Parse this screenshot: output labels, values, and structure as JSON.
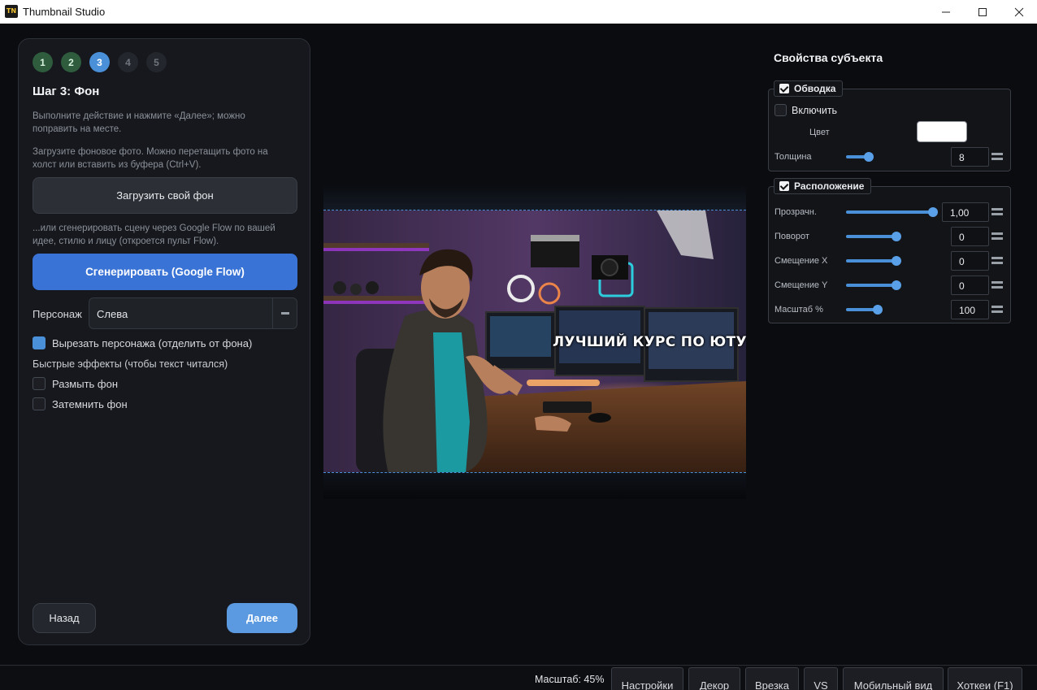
{
  "window": {
    "logo": "TN",
    "title": "Thumbnail Studio"
  },
  "wizard": {
    "steps": [
      {
        "number": "1",
        "state": "done"
      },
      {
        "number": "2",
        "state": "done"
      },
      {
        "number": "3",
        "state": "active"
      },
      {
        "number": "4",
        "state": "todo"
      },
      {
        "number": "5",
        "state": "todo"
      }
    ],
    "title": "Шаг 3: Фон",
    "hint_action": "Выполните действие и нажмите «Далее»; можно поправить на месте.",
    "hint_upload": "Загрузите фоновое фото. Можно перетащить фото на холст или вставить из буфера (Ctrl+V).",
    "upload_button": "Загрузить свой фон",
    "hint_generate": "...или сгенерировать сцену через Google Flow по вашей идее, стилю и лицу (откроется пульт Flow).",
    "generate_button": "Сгенерировать (Google Flow)",
    "character_label": "Персонаж",
    "character_value": "Слева",
    "cutout_label": "Вырезать персонажа (отделить от фона)",
    "cutout_checked": true,
    "effects_label": "Быстрые эффекты (чтобы текст читался)",
    "blur_label": "Размыть фон",
    "blur_checked": false,
    "darken_label": "Затемнить фон",
    "darken_checked": false,
    "back_button": "Назад",
    "next_button": "Далее"
  },
  "canvas": {
    "headline": "ЛУЧШИЙ КУРС ПО ЮТУБУ"
  },
  "properties": {
    "title": "Свойства субъекта",
    "stroke": {
      "header": "Обводка",
      "enable_label": "Включить",
      "enabled": false,
      "color_label": "Цвет",
      "color": "#ffffff",
      "thickness_label": "Толщина",
      "thickness": "8"
    },
    "placement": {
      "header": "Расположение",
      "opacity_label": "Прозрачн.",
      "opacity": "1,00",
      "rotation_label": "Поворот",
      "rotation": "0",
      "offset_x_label": "Смещение X",
      "offset_x": "0",
      "offset_y_label": "Смещение Y",
      "offset_y": "0",
      "scale_label": "Масштаб %",
      "scale": "100"
    }
  },
  "bottom_bar": {
    "zoom": "Масштаб: 45%",
    "buttons": [
      "Настройки",
      "Декор",
      "Врезка",
      "VS",
      "Мобильный вид",
      "Хоткеи (F1)"
    ]
  },
  "colors": {
    "accent": "#4a90d9",
    "primary_button": "#3a73d6",
    "step_done": "#2e5c3d",
    "background": "#0b0c0f"
  },
  "icons": [
    "app-logo-icon",
    "minimize-icon",
    "maximize-icon",
    "close-icon",
    "spin-icon"
  ]
}
